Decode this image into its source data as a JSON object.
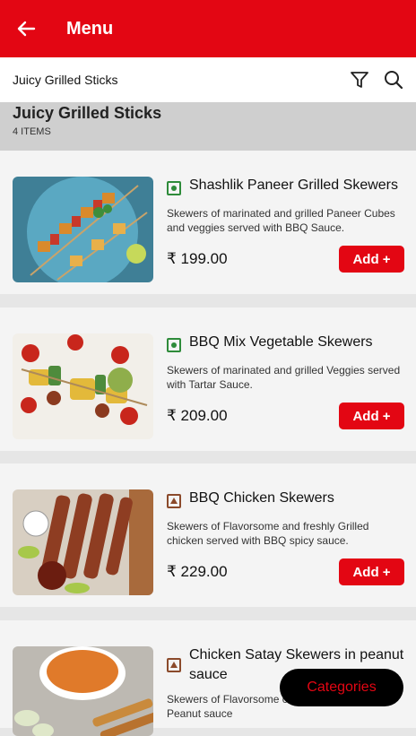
{
  "header": {
    "title": "Menu",
    "back_icon": "arrow-left-icon"
  },
  "subheader": {
    "category": "Juicy Grilled Sticks",
    "filter_icon": "filter-icon",
    "search_icon": "search-icon"
  },
  "section": {
    "name": "Juicy Grilled Sticks",
    "count": "4 ITEMS"
  },
  "items": [
    {
      "name": "Shashlik Paneer  Grilled Skewers",
      "description": "Skewers of marinated and grilled Paneer Cubes and veggies served with BBQ Sauce.",
      "price": "₹ 199.00",
      "add_label": "Add +",
      "diet": "veg"
    },
    {
      "name": "BBQ Mix Vegetable Skewers",
      "description": "Skewers of marinated and grilled  Veggies served with Tartar Sauce.",
      "price": "₹ 209.00",
      "add_label": "Add +",
      "diet": "veg"
    },
    {
      "name": "BBQ Chicken Skewers",
      "description": "Skewers of Flavorsome and freshly Grilled chicken served with BBQ spicy sauce.",
      "price": "₹ 229.00",
      "add_label": "Add +",
      "diet": "non-veg"
    },
    {
      "name": "Chicken Satay Skewers in peanut sauce",
      "description": "Skewers of  Flavorsome chicken served with Peanut sauce",
      "diet": "non-veg"
    }
  ],
  "categories_button": "Categories",
  "colors": {
    "brand_red": "#e30613",
    "veg_green": "#2e8b3a",
    "nonveg_brown": "#8b4a2b"
  }
}
